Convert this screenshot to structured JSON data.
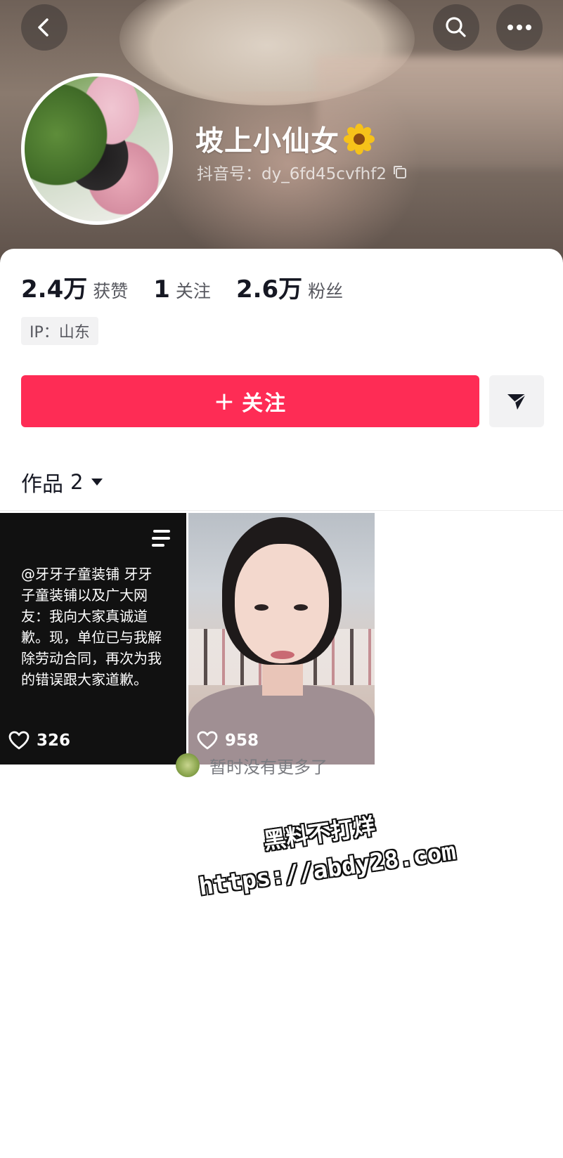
{
  "profile": {
    "name": "坡上小仙女",
    "douyin_id": "抖音号：dy_6fd45cvfhf2"
  },
  "stats": [
    {
      "value": "2.4万",
      "label": "获赞"
    },
    {
      "value": "1",
      "label": "关注"
    },
    {
      "value": "2.6万",
      "label": "粉丝"
    }
  ],
  "ip_location": "IP：山东",
  "actions": {
    "follow_label": "关注"
  },
  "works_tab": {
    "label": "作品",
    "count": "2"
  },
  "videos": [
    {
      "text": "@牙牙子童装铺 牙牙子童装铺以及广大网友：我向大家真诚道歉。现，单位已与我解除劳动合同，再次为我的错误跟大家道歉。",
      "likes": "326"
    },
    {
      "likes": "958"
    }
  ],
  "end_note": "暂时没有更多了",
  "watermark": {
    "line1": "黑料不打烊",
    "line2": "https://abdy28.com"
  },
  "colors": {
    "follow_button": "#fe2c55",
    "background": "#ffffff"
  }
}
